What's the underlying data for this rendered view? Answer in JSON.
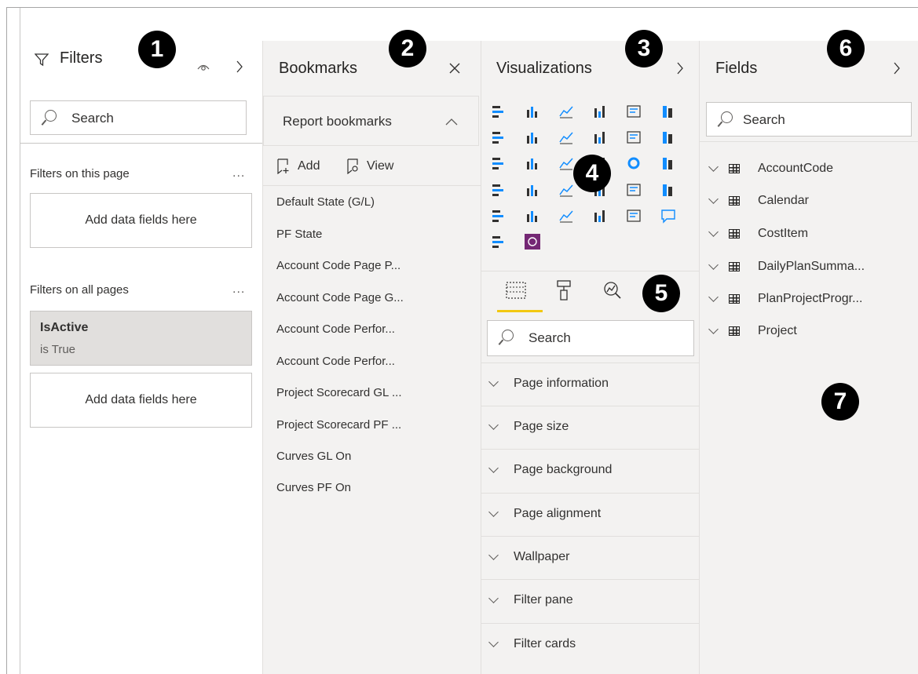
{
  "filters": {
    "title": "Filters",
    "search_placeholder": "Search",
    "this_page_label": "Filters on this page",
    "this_page_drop": "Add data fields here",
    "all_pages_label": "Filters on all pages",
    "card_field": "IsActive",
    "card_condition": "is True",
    "all_pages_drop": "Add data fields here",
    "more": "..."
  },
  "bookmarks": {
    "title": "Bookmarks",
    "section": "Report bookmarks",
    "add_label": "Add",
    "view_label": "View",
    "items": [
      "Default State (G/L)",
      "PF State",
      "Account Code Page P...",
      "Account Code Page G...",
      "Account Code Perfor...",
      "Account Code Perfor...",
      "Project Scorecard GL ...",
      "Project Scorecard PF ...",
      "Curves GL On",
      "Curves PF On"
    ]
  },
  "visualizations": {
    "title": "Visualizations",
    "search_placeholder": "Search",
    "sections": [
      "Page information",
      "Page size",
      "Page background",
      "Page alignment",
      "Wallpaper",
      "Filter pane",
      "Filter cards"
    ],
    "accent_color": "#f2c811"
  },
  "fields": {
    "title": "Fields",
    "search_placeholder": "Search",
    "tables": [
      "AccountCode",
      "Calendar",
      "CostItem",
      "DailyPlanSumma...",
      "PlanProjectProgr...",
      "Project"
    ]
  },
  "callouts": [
    "1",
    "2",
    "3",
    "4",
    "5",
    "6",
    "7"
  ]
}
